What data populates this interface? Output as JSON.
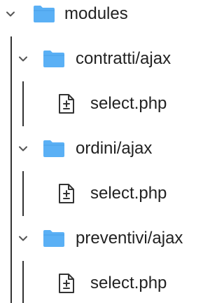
{
  "tree": {
    "root": {
      "label": "modules",
      "icon": "folder-icon",
      "expanded": true,
      "children": [
        {
          "label": "contratti/ajax",
          "icon": "folder-icon",
          "expanded": true,
          "children": [
            {
              "label": "select.php",
              "icon": "file-diff-icon"
            }
          ]
        },
        {
          "label": "ordini/ajax",
          "icon": "folder-icon",
          "expanded": true,
          "children": [
            {
              "label": "select.php",
              "icon": "file-diff-icon"
            }
          ]
        },
        {
          "label": "preventivi/ajax",
          "icon": "folder-icon",
          "expanded": true,
          "children": [
            {
              "label": "select.php",
              "icon": "file-diff-icon"
            }
          ]
        }
      ]
    }
  },
  "colors": {
    "folder": "#5ab0f5",
    "guide": "#333333",
    "text": "#222222",
    "chevron": "#555555"
  }
}
